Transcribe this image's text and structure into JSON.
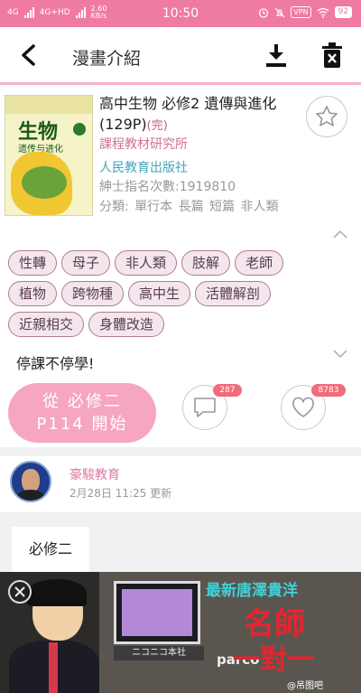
{
  "status_bar": {
    "network_labels": [
      "4G",
      "4G+HD"
    ],
    "speed": "2.60",
    "speed_unit": "KB/s",
    "time": "10:50",
    "vpn": "VPN",
    "battery": "92"
  },
  "app_bar": {
    "title": "漫畫介紹",
    "back_icon": "arrow-left",
    "download_icon": "download",
    "delete_icon": "trash-x"
  },
  "colors": {
    "status_bar": "#ef7aa3",
    "accent_pink": "#f6a6c0",
    "author": "#d0719b",
    "publisher": "#44a4b8",
    "badge_red": "#f06c7c"
  },
  "manga": {
    "cover": {
      "title": "生物",
      "subtitle": "遗传与进化"
    },
    "title": "高中生物 必修2 遺傳與進化(129P)",
    "status": "(完)",
    "author": "課程教材研究所",
    "publisher": "人民教育出版社",
    "views": "紳士指名次數:1919810",
    "category": "分類:  單行本 長篇 短篇 非人類"
  },
  "tags": [
    [
      "性轉",
      "母子",
      "非人類",
      "肢解",
      "老師"
    ],
    [
      "植物",
      "跨物種",
      "高中生",
      "活體解剖"
    ],
    [
      "近親相交",
      "身體改造"
    ]
  ],
  "description": "停課不停學!",
  "actions": {
    "read_line1": "從  必修二",
    "read_line2": "P114  開始",
    "comment_count": "287",
    "like_count": "8783"
  },
  "update": {
    "uploader": "豪駿教育",
    "time": "2月28日 11:25 更新"
  },
  "chapter": {
    "title": "必修二"
  },
  "ad": {
    "headline": "最新唐澤貴洋",
    "big_text": "名師",
    "big_text2": "一對一",
    "sign": "ニコニコ本社",
    "sign2": "parco",
    "watermark": "@吊图吧"
  }
}
